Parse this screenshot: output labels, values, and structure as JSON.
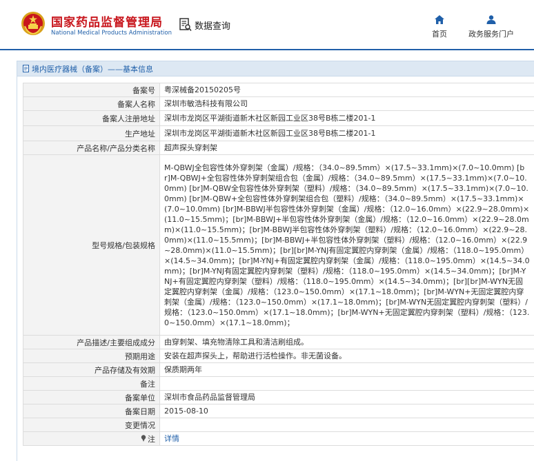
{
  "header": {
    "site_name_cn": "国家药品监督管理局",
    "site_name_en": "National Medical Products Administration",
    "query_label": "数据查询",
    "nav": [
      {
        "label": "首页",
        "icon": "home-icon"
      },
      {
        "label": "政务服务门户",
        "icon": "user-icon"
      }
    ],
    "accent_color": "#1f5fa9",
    "brand_red": "#c8161d"
  },
  "breadcrumb": {
    "text": "境内医疗器械（备案）——基本信息"
  },
  "rows": [
    {
      "label": "备案号",
      "value": "粤深械备20150205号"
    },
    {
      "label": "备案人名称",
      "value": "深圳市敏浩科技有限公司"
    },
    {
      "label": "备案人注册地址",
      "value": "深圳市龙岗区平湖街道新木社区新园工业区38号B栋二楼201-1"
    },
    {
      "label": "生产地址",
      "value": "深圳市龙岗区平湖街道新木社区新园工业区38号B栋二楼201-1"
    },
    {
      "label": "产品名称/产品分类名称",
      "value": "超声探头穿刺架"
    },
    {
      "label": "型号规格/包装规格",
      "value": "M-QBWJ全包容性体外穿刺架（金属）/规格：（34.0~89.5mm）×(17.5~33.1mm)×(7.0~10.0mm) [br]M-QBWJ+全包容性体外穿刺架组合包（金属）/规格：（34.0~89.5mm）×(17.5~33.1mm)×(7.0~10.0mm) [br]M-QBW全包容性体外穿刺架（塑料）/规格：（34.0~89.5mm）×(17.5~33.1mm)×(7.0~10.0mm) [br]M-QBW+全包容性体外穿刺架组合包（塑料）/规格：（34.0~89.5mm）×(17.5~33.1mm)×(7.0~10.0mm) [br]M-BBWJ半包容性体外穿刺架（金属）/规格：（12.0~16.0mm）×(22.9~28.0mm)×(11.0~15.5mm)；[br]M-BBWJ+半包容性体外穿刺架（金属）/规格：（12.0~16.0mm）×(22.9~28.0mm)×(11.0~15.5mm)；[br]M-BBWJ半包容性体外穿刺架（塑料）/规格：（12.0~16.0mm）×(22.9~28.0mm)×(11.0~15.5mm)；[br]M-BBWJ+半包容性体外穿刺架（塑料）/规格：（12.0~16.0mm）×(22.9~28.0mm)×(11.0~15.5mm)；[br][br]M-YNJ有固定翼腔内穿刺架（金属）/规格：（118.0~195.0mm）×(14.5~34.0mm)；[br]M-YNJ+有固定翼腔内穿刺架（金属）/规格：（118.0~195.0mm）×(14.5~34.0mm)；[br]M-YNJ有固定翼腔内穿刺架（塑料）/规格：（118.0~195.0mm）×(14.5~34.0mm)；[br]M-YNJ+有固定翼腔内穿刺架（塑料）/规格：（118.0~195.0mm）×(14.5~34.0mm)；[br][br]M-WYN无固定翼腔内穿刺架（金属）/规格：（123.0~150.0mm）×(17.1~18.0mm)；[br]M-WYN+无固定翼腔内穿刺架（金属）/规格：（123.0~150.0mm）×(17.1~18.0mm)；[br]M-WYN无固定翼腔内穿刺架（塑料）/规格：（123.0~150.0mm）×(17.1~18.0mm)；[br]M-WYN+无固定翼腔内穿刺架（塑料）/规格：（123.0~150.0mm）×(17.1~18.0mm)；"
    },
    {
      "label": "产品描述/主要组成成分",
      "value": "由穿刺架、填充物清除工具和清洁刷组成。"
    },
    {
      "label": "预期用途",
      "value": "安装在超声探头上，帮助进行活检操作。非无菌设备。"
    },
    {
      "label": "产品存储及有效期",
      "value": "保质期两年"
    },
    {
      "label": "备注",
      "value": ""
    },
    {
      "label": "备案单位",
      "value": "深圳市食品药品监督管理局"
    },
    {
      "label": "备案日期",
      "value": "2015-08-10"
    },
    {
      "label": "变更情况",
      "value": ""
    },
    {
      "label": "注",
      "value": "详情"
    }
  ]
}
